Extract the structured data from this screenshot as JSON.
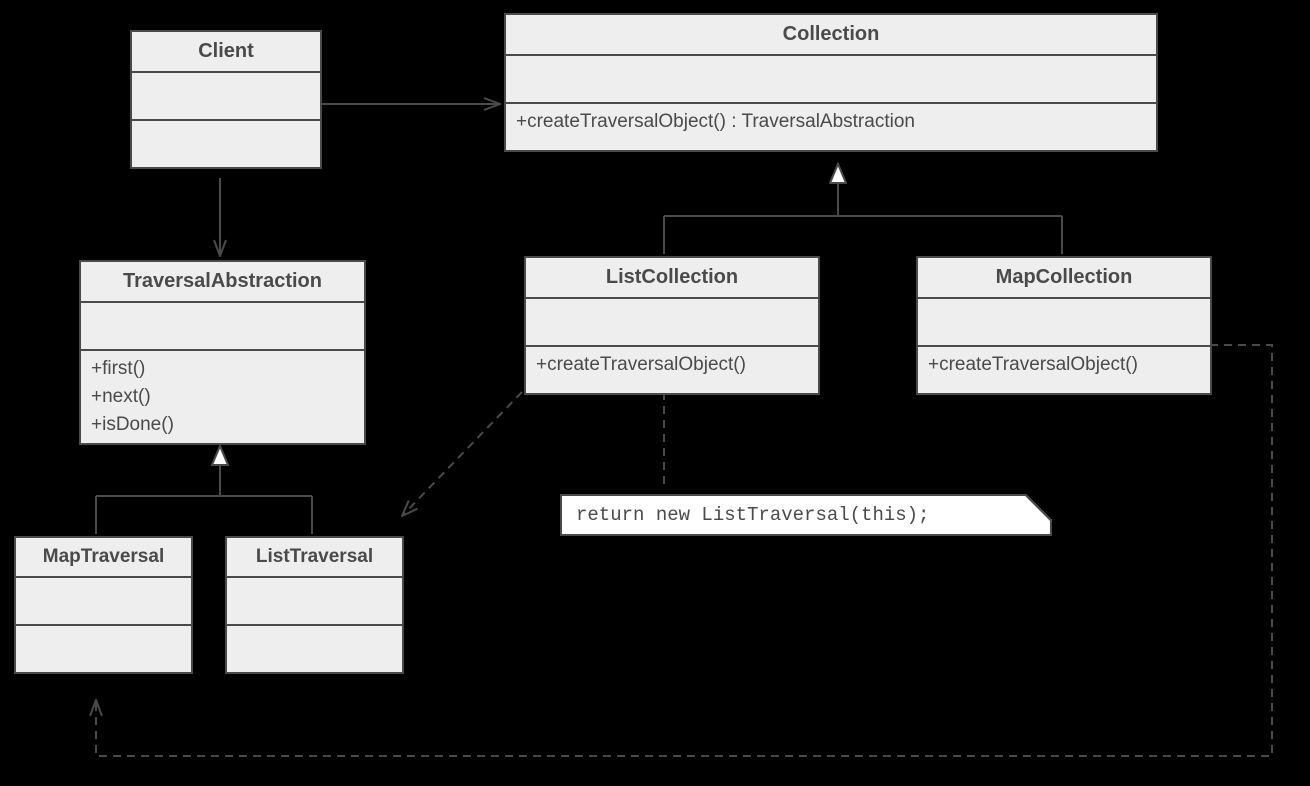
{
  "classes": {
    "client": {
      "name": "Client"
    },
    "collection": {
      "name": "Collection",
      "ops": [
        "+createTraversalObject() : TraversalAbstraction"
      ]
    },
    "traversalAbstraction": {
      "name": "TraversalAbstraction",
      "ops": [
        "+first()",
        "+next()",
        "+isDone()"
      ]
    },
    "listCollection": {
      "name": "ListCollection",
      "ops": [
        "+createTraversalObject()"
      ]
    },
    "mapCollection": {
      "name": "MapCollection",
      "ops": [
        "+createTraversalObject()"
      ]
    },
    "mapTraversal": {
      "name": "MapTraversal"
    },
    "listTraversal": {
      "name": "ListTraversal"
    }
  },
  "note": {
    "text": "return new ListTraversal(this);"
  }
}
